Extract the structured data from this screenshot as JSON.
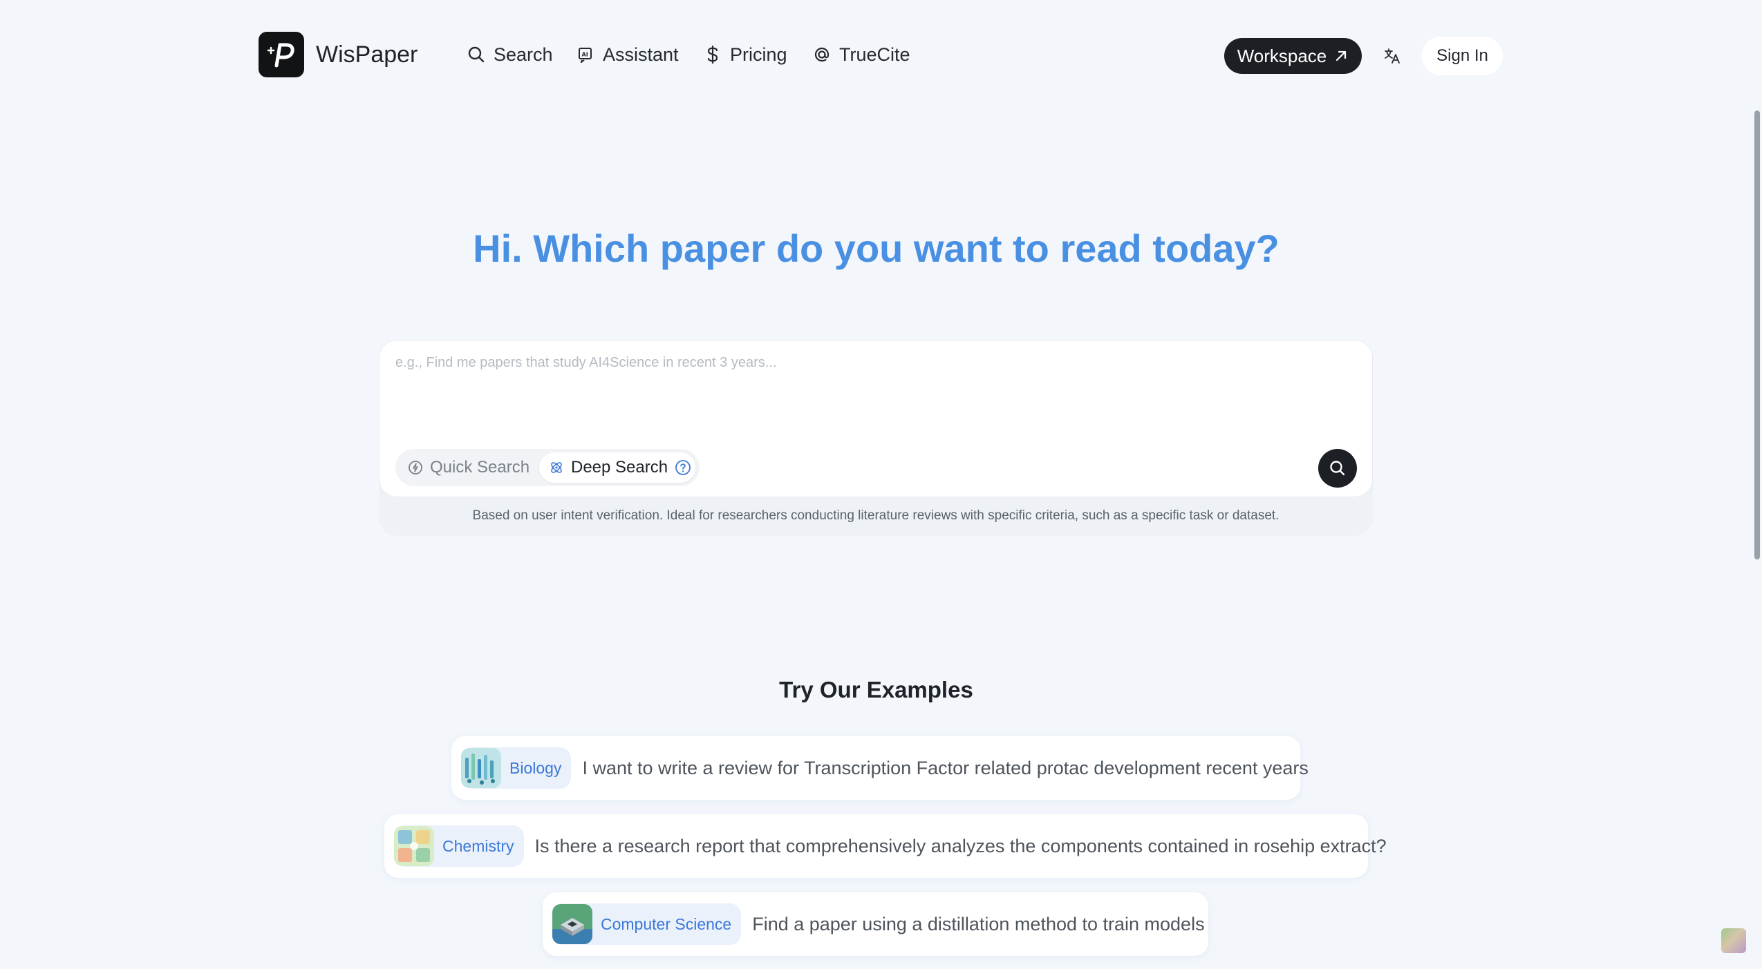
{
  "header": {
    "brand": "WisPaper",
    "nav": [
      {
        "label": "Search",
        "icon": "search-icon"
      },
      {
        "label": "Assistant",
        "icon": "ai-icon"
      },
      {
        "label": "Pricing",
        "icon": "dollar-icon"
      },
      {
        "label": "TrueCite",
        "icon": "at-icon"
      }
    ],
    "workspace_label": "Workspace",
    "signin_label": "Sign In"
  },
  "hero": {
    "title": "Hi. Which paper do you want to read today?"
  },
  "search": {
    "placeholder": "e.g., Find me papers that study AI4Science in recent 3 years...",
    "modes": {
      "quick": "Quick Search",
      "deep": "Deep Search",
      "selected": "Deep Search"
    },
    "description": "Based on user intent verification. Ideal for researchers conducting literature reviews with specific criteria, such as a specific task or dataset."
  },
  "examples": {
    "title": "Try Our Examples",
    "items": [
      {
        "tag": "Biology",
        "text": "I want to write a review for Transcription Factor related protac development recent years"
      },
      {
        "tag": "Chemistry",
        "text": "Is there a research report that comprehensively analyzes the components contained in rosehip extract?"
      },
      {
        "tag": "Computer Science",
        "text": "Find a paper using a distillation method to train models"
      }
    ]
  },
  "colors": {
    "accent": "#4a90e2",
    "dark": "#1c1f23",
    "background": "#f3f7fc",
    "tag_text": "#3b78d8"
  }
}
